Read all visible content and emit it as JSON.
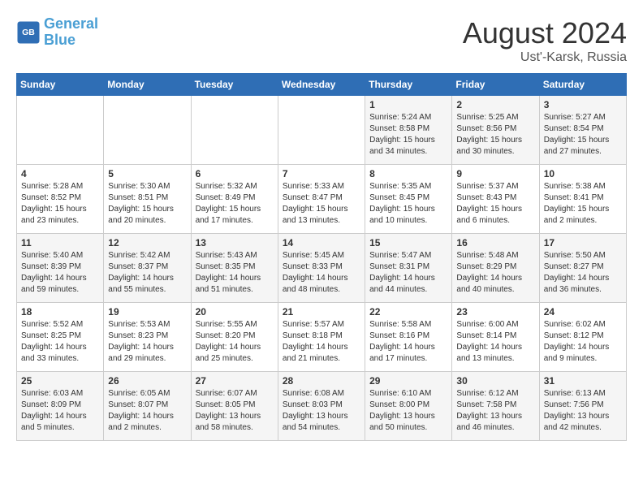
{
  "header": {
    "logo_line1": "General",
    "logo_line2": "Blue",
    "month": "August 2024",
    "location": "Ust'-Karsk, Russia"
  },
  "weekdays": [
    "Sunday",
    "Monday",
    "Tuesday",
    "Wednesday",
    "Thursday",
    "Friday",
    "Saturday"
  ],
  "weeks": [
    [
      {
        "day": "",
        "content": ""
      },
      {
        "day": "",
        "content": ""
      },
      {
        "day": "",
        "content": ""
      },
      {
        "day": "",
        "content": ""
      },
      {
        "day": "1",
        "content": "Sunrise: 5:24 AM\nSunset: 8:58 PM\nDaylight: 15 hours\nand 34 minutes."
      },
      {
        "day": "2",
        "content": "Sunrise: 5:25 AM\nSunset: 8:56 PM\nDaylight: 15 hours\nand 30 minutes."
      },
      {
        "day": "3",
        "content": "Sunrise: 5:27 AM\nSunset: 8:54 PM\nDaylight: 15 hours\nand 27 minutes."
      }
    ],
    [
      {
        "day": "4",
        "content": "Sunrise: 5:28 AM\nSunset: 8:52 PM\nDaylight: 15 hours\nand 23 minutes."
      },
      {
        "day": "5",
        "content": "Sunrise: 5:30 AM\nSunset: 8:51 PM\nDaylight: 15 hours\nand 20 minutes."
      },
      {
        "day": "6",
        "content": "Sunrise: 5:32 AM\nSunset: 8:49 PM\nDaylight: 15 hours\nand 17 minutes."
      },
      {
        "day": "7",
        "content": "Sunrise: 5:33 AM\nSunset: 8:47 PM\nDaylight: 15 hours\nand 13 minutes."
      },
      {
        "day": "8",
        "content": "Sunrise: 5:35 AM\nSunset: 8:45 PM\nDaylight: 15 hours\nand 10 minutes."
      },
      {
        "day": "9",
        "content": "Sunrise: 5:37 AM\nSunset: 8:43 PM\nDaylight: 15 hours\nand 6 minutes."
      },
      {
        "day": "10",
        "content": "Sunrise: 5:38 AM\nSunset: 8:41 PM\nDaylight: 15 hours\nand 2 minutes."
      }
    ],
    [
      {
        "day": "11",
        "content": "Sunrise: 5:40 AM\nSunset: 8:39 PM\nDaylight: 14 hours\nand 59 minutes."
      },
      {
        "day": "12",
        "content": "Sunrise: 5:42 AM\nSunset: 8:37 PM\nDaylight: 14 hours\nand 55 minutes."
      },
      {
        "day": "13",
        "content": "Sunrise: 5:43 AM\nSunset: 8:35 PM\nDaylight: 14 hours\nand 51 minutes."
      },
      {
        "day": "14",
        "content": "Sunrise: 5:45 AM\nSunset: 8:33 PM\nDaylight: 14 hours\nand 48 minutes."
      },
      {
        "day": "15",
        "content": "Sunrise: 5:47 AM\nSunset: 8:31 PM\nDaylight: 14 hours\nand 44 minutes."
      },
      {
        "day": "16",
        "content": "Sunrise: 5:48 AM\nSunset: 8:29 PM\nDaylight: 14 hours\nand 40 minutes."
      },
      {
        "day": "17",
        "content": "Sunrise: 5:50 AM\nSunset: 8:27 PM\nDaylight: 14 hours\nand 36 minutes."
      }
    ],
    [
      {
        "day": "18",
        "content": "Sunrise: 5:52 AM\nSunset: 8:25 PM\nDaylight: 14 hours\nand 33 minutes."
      },
      {
        "day": "19",
        "content": "Sunrise: 5:53 AM\nSunset: 8:23 PM\nDaylight: 14 hours\nand 29 minutes."
      },
      {
        "day": "20",
        "content": "Sunrise: 5:55 AM\nSunset: 8:20 PM\nDaylight: 14 hours\nand 25 minutes."
      },
      {
        "day": "21",
        "content": "Sunrise: 5:57 AM\nSunset: 8:18 PM\nDaylight: 14 hours\nand 21 minutes."
      },
      {
        "day": "22",
        "content": "Sunrise: 5:58 AM\nSunset: 8:16 PM\nDaylight: 14 hours\nand 17 minutes."
      },
      {
        "day": "23",
        "content": "Sunrise: 6:00 AM\nSunset: 8:14 PM\nDaylight: 14 hours\nand 13 minutes."
      },
      {
        "day": "24",
        "content": "Sunrise: 6:02 AM\nSunset: 8:12 PM\nDaylight: 14 hours\nand 9 minutes."
      }
    ],
    [
      {
        "day": "25",
        "content": "Sunrise: 6:03 AM\nSunset: 8:09 PM\nDaylight: 14 hours\nand 5 minutes."
      },
      {
        "day": "26",
        "content": "Sunrise: 6:05 AM\nSunset: 8:07 PM\nDaylight: 14 hours\nand 2 minutes."
      },
      {
        "day": "27",
        "content": "Sunrise: 6:07 AM\nSunset: 8:05 PM\nDaylight: 13 hours\nand 58 minutes."
      },
      {
        "day": "28",
        "content": "Sunrise: 6:08 AM\nSunset: 8:03 PM\nDaylight: 13 hours\nand 54 minutes."
      },
      {
        "day": "29",
        "content": "Sunrise: 6:10 AM\nSunset: 8:00 PM\nDaylight: 13 hours\nand 50 minutes."
      },
      {
        "day": "30",
        "content": "Sunrise: 6:12 AM\nSunset: 7:58 PM\nDaylight: 13 hours\nand 46 minutes."
      },
      {
        "day": "31",
        "content": "Sunrise: 6:13 AM\nSunset: 7:56 PM\nDaylight: 13 hours\nand 42 minutes."
      }
    ]
  ]
}
